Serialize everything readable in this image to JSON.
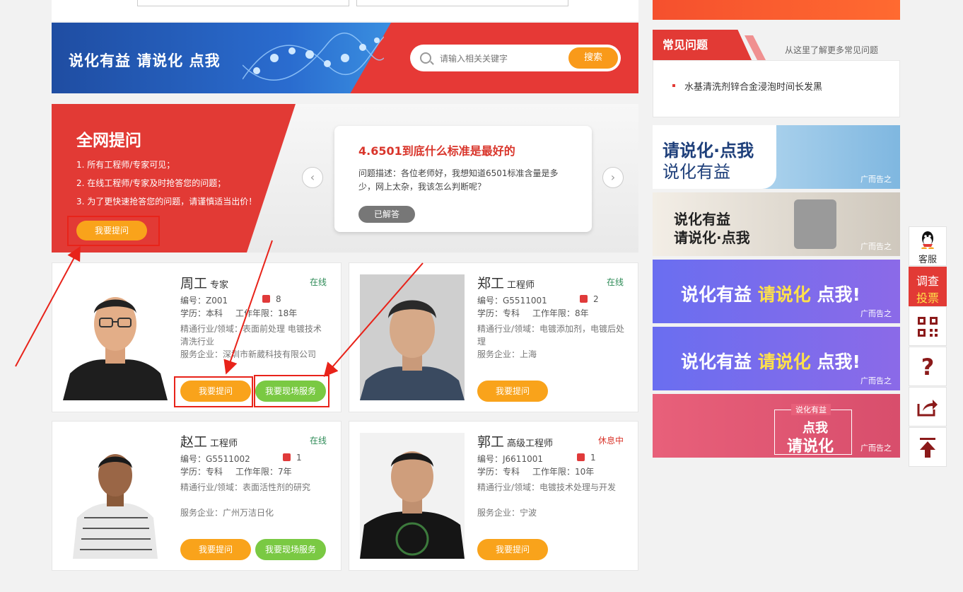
{
  "search_banner": {
    "slogan": "说化有益 请说化 点我",
    "search_placeholder": "请输入相关关键字",
    "search_button": "搜索"
  },
  "ask_panel": {
    "title": "全网提问",
    "lines": [
      "1. 所有工程师/专家可见；",
      "2. 在线工程师/专家及时抢答您的问题；",
      "3. 为了更快速抢答您的问题，请谨慎适当出价！"
    ],
    "ask_button": "我要提问",
    "question": {
      "title": "4.6501到底什么标准是最好的",
      "description": "问题描述：各位老师好，我想知道6501标准含量是多少，网上太杂，我该怎么判断呢？",
      "status": "已解答"
    }
  },
  "experts": [
    {
      "name": "周工",
      "title": "专家",
      "status": "在线",
      "likes": "8",
      "id": "编号：Z001",
      "education": "学历：本科",
      "years": "工作年限：18年",
      "field": "精通行业/领域：表面前处理 电镀技术 清洗行业",
      "company": "服务企业：深圳市新葳科技有限公司",
      "ask_button": "我要提问",
      "site_button": "我要现场服务"
    },
    {
      "name": "郑工",
      "title": "工程师",
      "status": "在线",
      "likes": "2",
      "id": "编号：G5511001",
      "education": "学历：专科",
      "years": "工作年限：8年",
      "field": "精通行业/领域：电镀添加剂，电镀后处理",
      "company": "服务企业：上海",
      "ask_button": "我要提问"
    },
    {
      "name": "赵工",
      "title": "工程师",
      "status": "在线",
      "likes": "1",
      "id": "编号：G5511002",
      "education": "学历：专科",
      "years": "工作年限：7年",
      "field": "精通行业/领域：表面活性剂的研究",
      "company": "服务企业：广州万洁日化",
      "ask_button": "我要提问",
      "site_button": "我要现场服务"
    },
    {
      "name": "郭工",
      "title": "高级工程师",
      "status": "休息中",
      "likes": "1",
      "id": "编号：J6611001",
      "education": "学历：专科",
      "years": "工作年限：10年",
      "field": "精通行业/领域：电镀技术处理与开发",
      "company": "服务企业：宁波",
      "ask_button": "我要提问"
    }
  ],
  "faq": {
    "tab": "常见问题",
    "more": "从这里了解更多常见问题",
    "items": [
      "水基清洗剂锌合金浸泡时间长发黑"
    ]
  },
  "ads": {
    "ad1_line1": "请说化·点我",
    "ad1_line2": "说化有益",
    "ad2_line1": "说化有益",
    "ad2_line2": "请说化·点我",
    "ad3_a": "说化有益",
    "ad3_b": "请说化",
    "ad3_c": "点我!",
    "ad5_tag": "说化有益",
    "ad5_line1": "点我",
    "ad5_line2": "请说化",
    "label": "广而告之"
  },
  "toolbar": {
    "service": "客服",
    "survey_line1": "调查",
    "survey_line2": "投票"
  },
  "colors": {
    "brand_red": "#e23a35",
    "orange": "#f9a31b",
    "green": "#7ac943",
    "online": "#2e8b57"
  }
}
